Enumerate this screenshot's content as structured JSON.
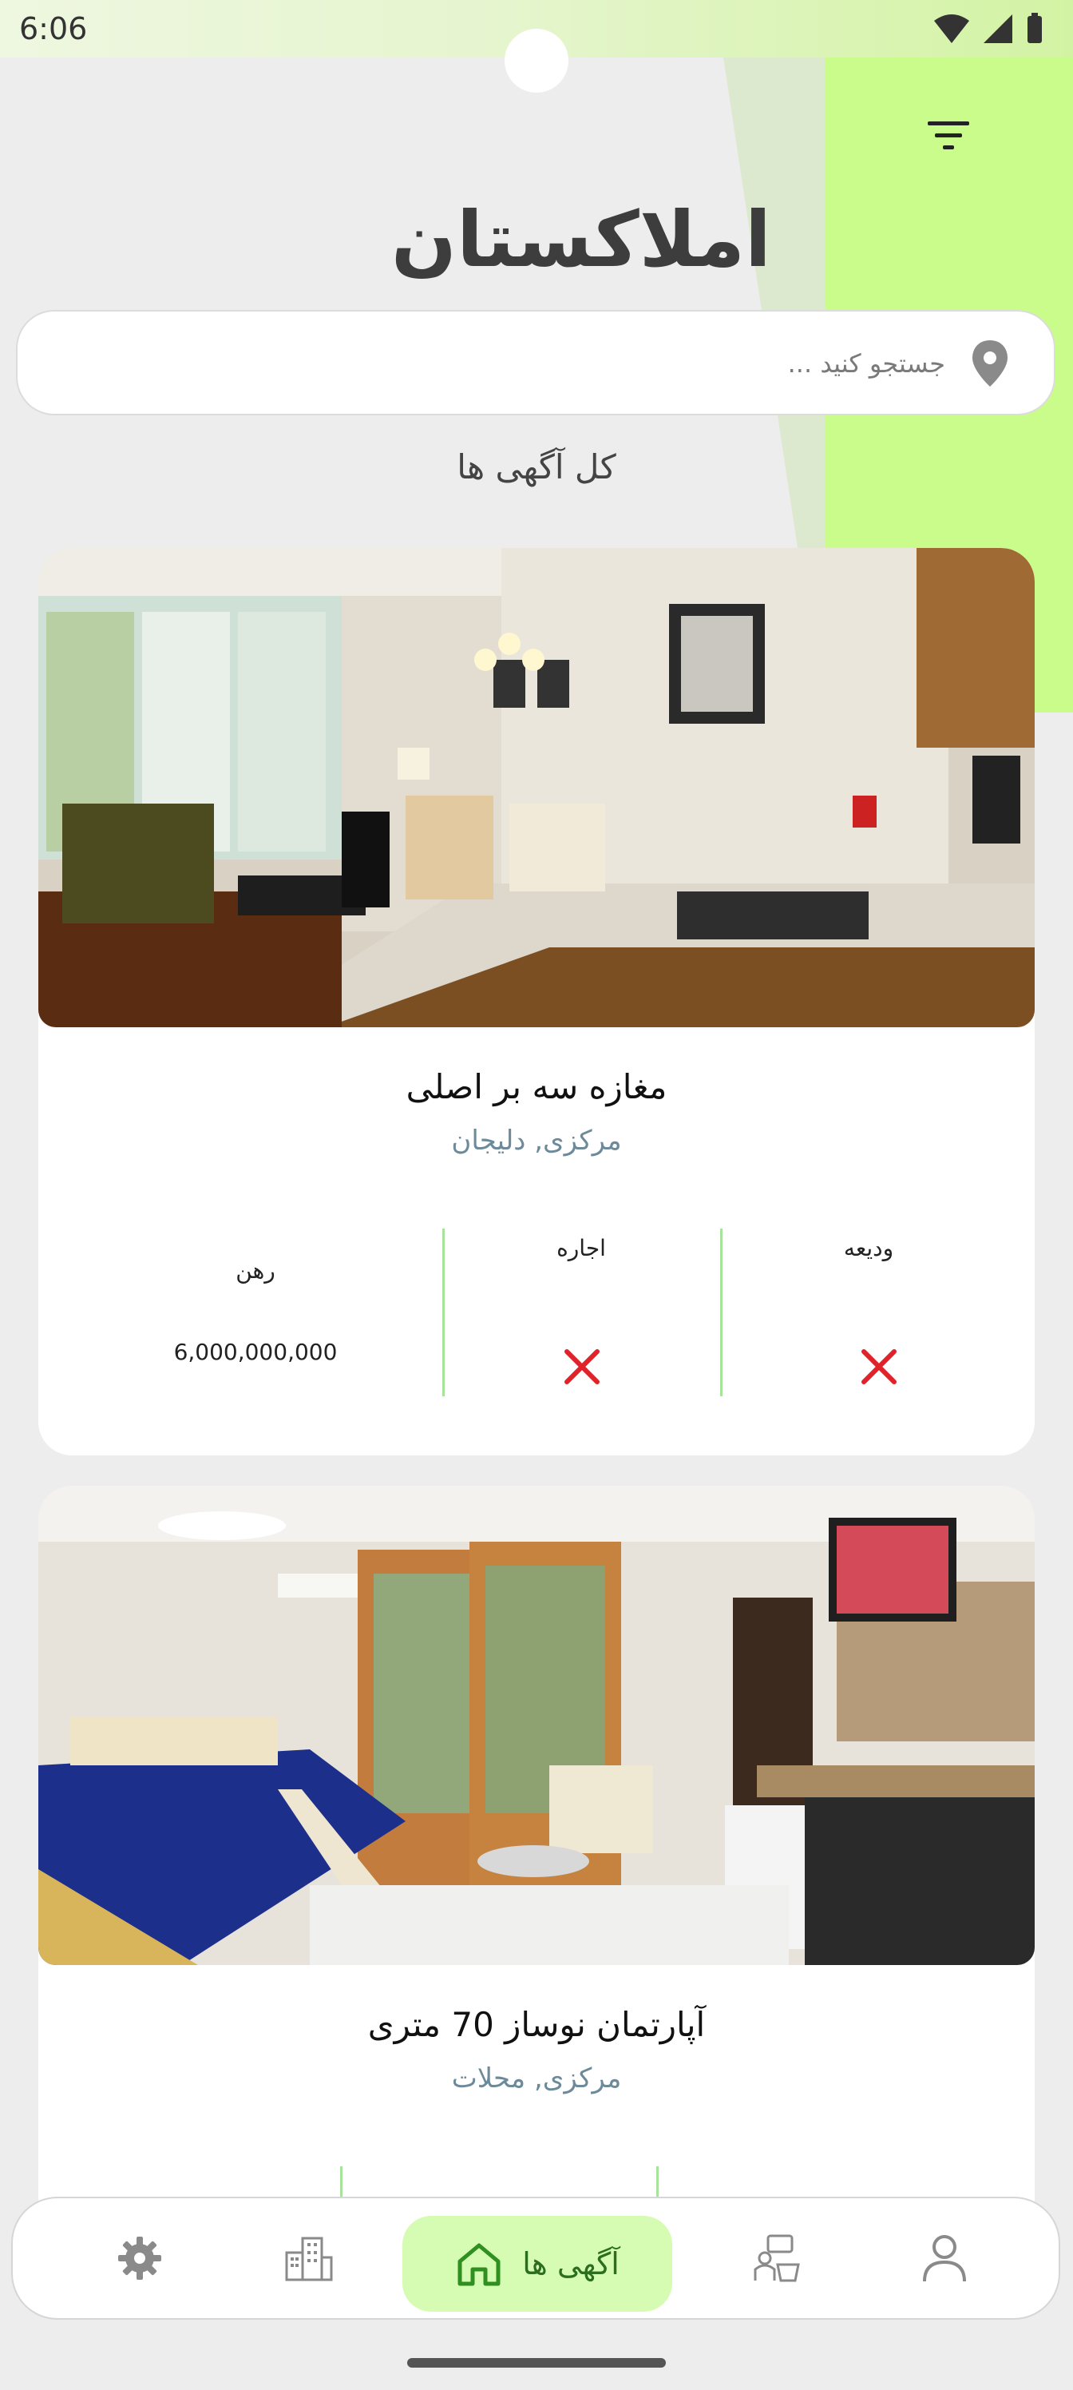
{
  "status_bar": {
    "time": "6:06"
  },
  "header": {
    "app_logo": "املاکستان"
  },
  "search": {
    "placeholder": "جستجو کنید ..."
  },
  "section": {
    "title": "کل آگهی ها"
  },
  "listings": [
    {
      "title": "مغازه سه بر اصلی",
      "location": "مرکزی, دلیجان",
      "columns": [
        {
          "label": "ودیعه",
          "value": null,
          "available": false
        },
        {
          "label": "اجاره",
          "value": null,
          "available": false
        },
        {
          "label": "رهن",
          "value": "6,000,000,000",
          "available": true
        }
      ]
    },
    {
      "title": "آپارتمان نوساز 70 متری",
      "location": "مرکزی, محلات",
      "columns": []
    }
  ],
  "bottom_nav": {
    "items": [
      {
        "name": "settings",
        "icon": "gear-icon"
      },
      {
        "name": "buildings",
        "icon": "buildings-icon"
      },
      {
        "name": "ads",
        "icon": "home-icon",
        "label": "آگهی ها",
        "active": true
      },
      {
        "name": "consultants",
        "icon": "consultant-icon"
      },
      {
        "name": "profile",
        "icon": "user-icon"
      }
    ]
  },
  "colors": {
    "accent_green": "#cafc8c",
    "active_nav_bg": "#d6fcb3",
    "x_red": "#e0232a",
    "divider_green": "#a7e39b"
  }
}
